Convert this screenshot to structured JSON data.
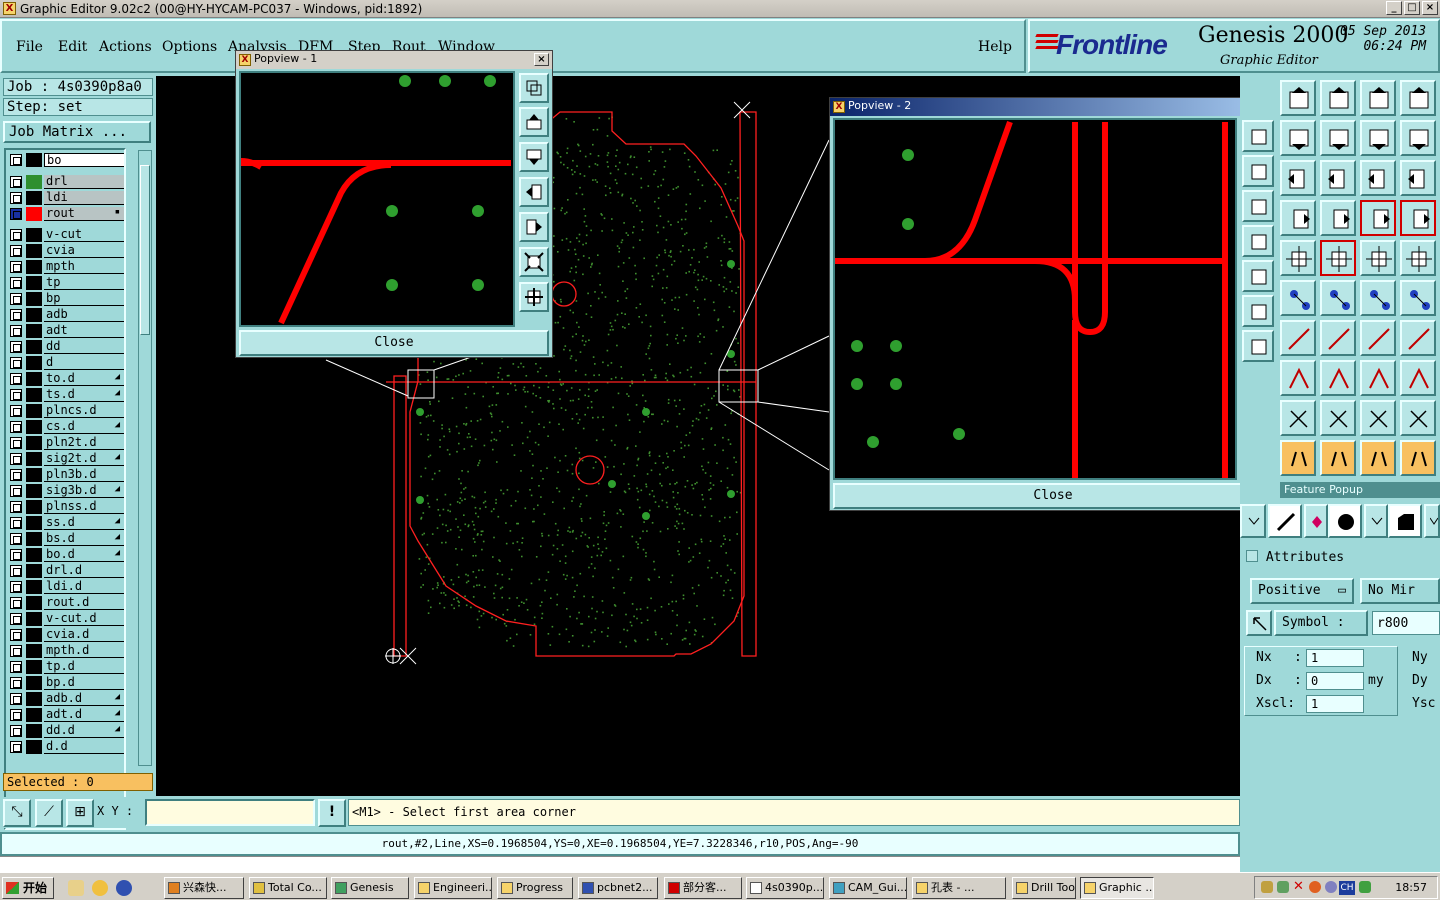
{
  "window": {
    "title": "Graphic Editor 9.02c2 (00@HY-HYCAM-PC037 - Windows, pid:1892)",
    "icon": "app-x-icon"
  },
  "menu": [
    "File",
    "Edit",
    "Actions",
    "Options",
    "Analysis",
    "DFM",
    "Step",
    "Rout",
    "Window"
  ],
  "help": "Help",
  "brand": {
    "logo": "Frontline",
    "product": "Genesis 2000",
    "subtitle": "Graphic Editor",
    "date": "05 Sep 2013",
    "time": "06:24 PM"
  },
  "job": {
    "job_label": "Job : 4s0390p8a0",
    "step_label": "Step: set",
    "matrix_button": "Job Matrix ..."
  },
  "layers": [
    {
      "name": "bo",
      "swatch": "#000000",
      "style": "white"
    },
    {
      "name": "drl",
      "swatch": "#2f8f2f",
      "style": "hl"
    },
    {
      "name": "ldi",
      "swatch": "#000000",
      "style": "hl"
    },
    {
      "name": "rout",
      "swatch": "#ff0000",
      "style": "hl",
      "mark": "▪",
      "active": true
    },
    {
      "name": "v-cut",
      "swatch": "#000000",
      "style": ""
    },
    {
      "name": "cvia",
      "swatch": "#000000",
      "style": ""
    },
    {
      "name": "mpth",
      "swatch": "#000000",
      "style": ""
    },
    {
      "name": "tp",
      "swatch": "#000000",
      "style": ""
    },
    {
      "name": "bp",
      "swatch": "#000000",
      "style": ""
    },
    {
      "name": "adb",
      "swatch": "#000000",
      "style": ""
    },
    {
      "name": "adt",
      "swatch": "#000000",
      "style": ""
    },
    {
      "name": "dd",
      "swatch": "#000000",
      "style": ""
    },
    {
      "name": "d",
      "swatch": "#000000",
      "style": ""
    },
    {
      "name": "to.d",
      "swatch": "#000000",
      "style": "",
      "mark": "◢"
    },
    {
      "name": "ts.d",
      "swatch": "#000000",
      "style": "",
      "mark": "◢"
    },
    {
      "name": "plncs.d",
      "swatch": "#000000",
      "style": ""
    },
    {
      "name": "cs.d",
      "swatch": "#000000",
      "style": "",
      "mark": "◢"
    },
    {
      "name": "pln2t.d",
      "swatch": "#000000",
      "style": ""
    },
    {
      "name": "sig2t.d",
      "swatch": "#000000",
      "style": "",
      "mark": "◢"
    },
    {
      "name": "pln3b.d",
      "swatch": "#000000",
      "style": ""
    },
    {
      "name": "sig3b.d",
      "swatch": "#000000",
      "style": "",
      "mark": "◢"
    },
    {
      "name": "plnss.d",
      "swatch": "#000000",
      "style": ""
    },
    {
      "name": "ss.d",
      "swatch": "#000000",
      "style": "",
      "mark": "◢"
    },
    {
      "name": "bs.d",
      "swatch": "#000000",
      "style": "",
      "mark": "◢"
    },
    {
      "name": "bo.d",
      "swatch": "#000000",
      "style": "",
      "mark": "◢"
    },
    {
      "name": "drl.d",
      "swatch": "#000000",
      "style": ""
    },
    {
      "name": "ldi.d",
      "swatch": "#000000",
      "style": ""
    },
    {
      "name": "rout.d",
      "swatch": "#000000",
      "style": ""
    },
    {
      "name": "v-cut.d",
      "swatch": "#000000",
      "style": ""
    },
    {
      "name": "cvia.d",
      "swatch": "#000000",
      "style": ""
    },
    {
      "name": "mpth.d",
      "swatch": "#000000",
      "style": ""
    },
    {
      "name": "tp.d",
      "swatch": "#000000",
      "style": ""
    },
    {
      "name": "bp.d",
      "swatch": "#000000",
      "style": ""
    },
    {
      "name": "adb.d",
      "swatch": "#000000",
      "style": "",
      "mark": "◢"
    },
    {
      "name": "adt.d",
      "swatch": "#000000",
      "style": "",
      "mark": "◢"
    },
    {
      "name": "dd.d",
      "swatch": "#000000",
      "style": "",
      "mark": "◢"
    },
    {
      "name": "d.d",
      "swatch": "#000000",
      "style": ""
    }
  ],
  "selected": "Selected : 0",
  "command": {
    "xy_label": "X Y :",
    "xy_value": "",
    "bang": "!",
    "prompt": "<M1> - Select first area corner"
  },
  "infobar": "rout,#2,Line,XS=0.1968504,YS=0,XE=0.1968504,YE=7.3228346,r10,POS,Ang=-90",
  "popview1": {
    "title": "Popview - 1",
    "close": "Close"
  },
  "popview2": {
    "title": "Popview - 2",
    "close": "Close"
  },
  "feature_popup": {
    "header": "Feature Popup",
    "attributes": "Attributes",
    "polarity": "Positive",
    "mirror": "No Mir",
    "symbol_label": "Symbol :",
    "symbol_value": "r800",
    "nx_label": "Nx",
    "nx_value": "1",
    "ny_label": "Ny",
    "dx_label": "Dx",
    "dx_value": "0",
    "dx_unit": "my",
    "dy_label": "Dy",
    "xscl_label": "Xscl:",
    "xscl_value": "1",
    "yscl_label": "Ysc"
  },
  "taskbar": {
    "start": "开始",
    "tasks": [
      "兴森快...",
      "Total Co...",
      "Genesis",
      "Engineeri...",
      "Progress",
      "pcbnet2...",
      "部分客...",
      "4s0390p...",
      "CAM_Gui...",
      "孔表 - ...",
      "Drill Tool ...",
      "Graphic ..."
    ],
    "active_task": 11,
    "ime": "CH",
    "clock": "18:57"
  },
  "colors": {
    "panel": "#9fd9d9",
    "rout": "#ff0000",
    "drill": "#2f8f2f",
    "canvas": "#000000"
  }
}
